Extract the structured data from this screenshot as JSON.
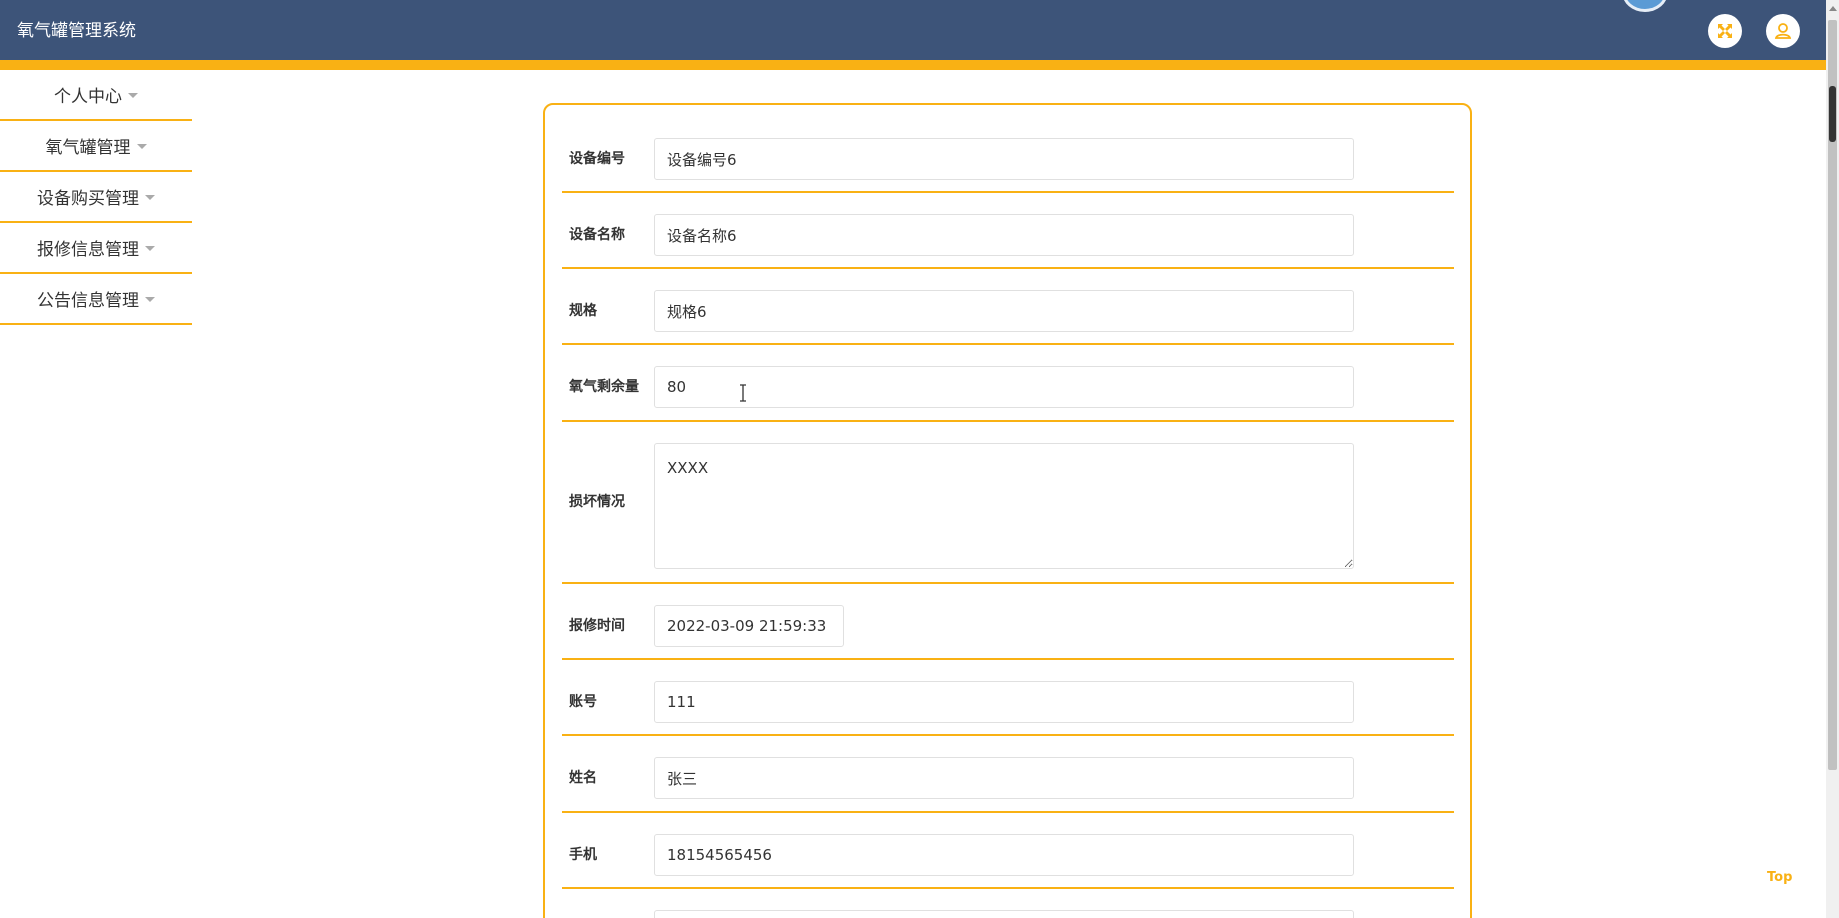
{
  "app": {
    "title": "氧气罐管理系统"
  },
  "header": {
    "fullscreen_icon": "fullscreen-icon",
    "user_icon": "user-icon",
    "accent_color": "#f9b114",
    "bar_color": "#3d5479"
  },
  "sidebar": {
    "items": [
      {
        "label": "个人中心"
      },
      {
        "label": "氧气罐管理"
      },
      {
        "label": "设备购买管理"
      },
      {
        "label": "报修信息管理"
      },
      {
        "label": "公告信息管理"
      }
    ]
  },
  "form": {
    "fields": [
      {
        "label": "设备编号",
        "value": "设备编号6"
      },
      {
        "label": "设备名称",
        "value": "设备名称6"
      },
      {
        "label": "规格",
        "value": "规格6"
      },
      {
        "label": "氧气剩余量",
        "value": "80"
      },
      {
        "label": "损坏情况",
        "value": "XXXX"
      },
      {
        "label": "报修时间",
        "value": "2022-03-09 21:59:33"
      },
      {
        "label": "账号",
        "value": "111"
      },
      {
        "label": "姓名",
        "value": "张三"
      },
      {
        "label": "手机",
        "value": "18154565456"
      }
    ]
  },
  "back_to_top": {
    "label": "Top"
  }
}
